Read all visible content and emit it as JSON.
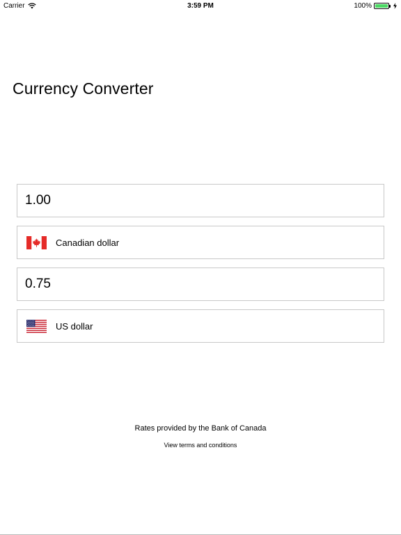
{
  "status_bar": {
    "carrier": "Carrier",
    "time": "3:59 PM",
    "battery": "100%",
    "battery_level": 1.0,
    "battery_color": "#4cd964",
    "icons": [
      "wifi-icon",
      "battery-icon",
      "charging-icon"
    ]
  },
  "title": "Currency Converter",
  "converter": {
    "from_amount": "1.00",
    "from_currency": {
      "label": "Canadian dollar",
      "flag": "canada-flag-icon"
    },
    "to_amount": "0.75",
    "to_currency": {
      "label": "US dollar",
      "flag": "usa-flag-icon"
    },
    "border_color": "#c8c8c8"
  },
  "footer": {
    "rates_credit": "Rates provided by the Bank of Canada",
    "terms_link": "View terms and conditions"
  }
}
